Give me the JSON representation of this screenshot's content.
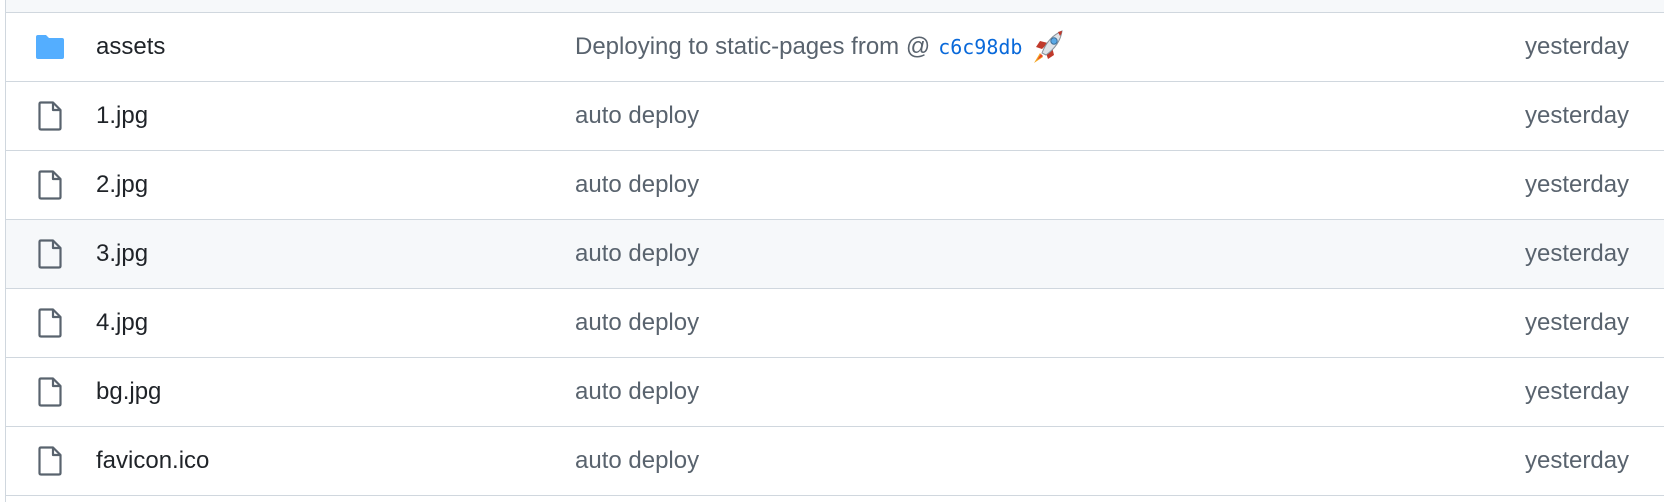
{
  "colors": {
    "folder": "#54aeff",
    "file_icon": "#59636e",
    "link": "#0969da",
    "hover_row": "#f6f8fa",
    "border": "#d0d7de"
  },
  "files": [
    {
      "type": "folder",
      "icon": "folder-icon",
      "name": "assets",
      "message": "Deploying to static-pages from @",
      "commit_sha": "c6c98db",
      "emoji": "rocket",
      "date": "yesterday"
    },
    {
      "type": "file",
      "icon": "file-icon",
      "name": "1.jpg",
      "message": "auto deploy",
      "date": "yesterday"
    },
    {
      "type": "file",
      "icon": "file-icon",
      "name": "2.jpg",
      "message": "auto deploy",
      "date": "yesterday"
    },
    {
      "type": "file",
      "icon": "file-icon",
      "name": "3.jpg",
      "message": "auto deploy",
      "date": "yesterday",
      "hovered": true
    },
    {
      "type": "file",
      "icon": "file-icon",
      "name": "4.jpg",
      "message": "auto deploy",
      "date": "yesterday"
    },
    {
      "type": "file",
      "icon": "file-icon",
      "name": "bg.jpg",
      "message": "auto deploy",
      "date": "yesterday"
    },
    {
      "type": "file",
      "icon": "file-icon",
      "name": "favicon.ico",
      "message": "auto deploy",
      "date": "yesterday"
    }
  ]
}
